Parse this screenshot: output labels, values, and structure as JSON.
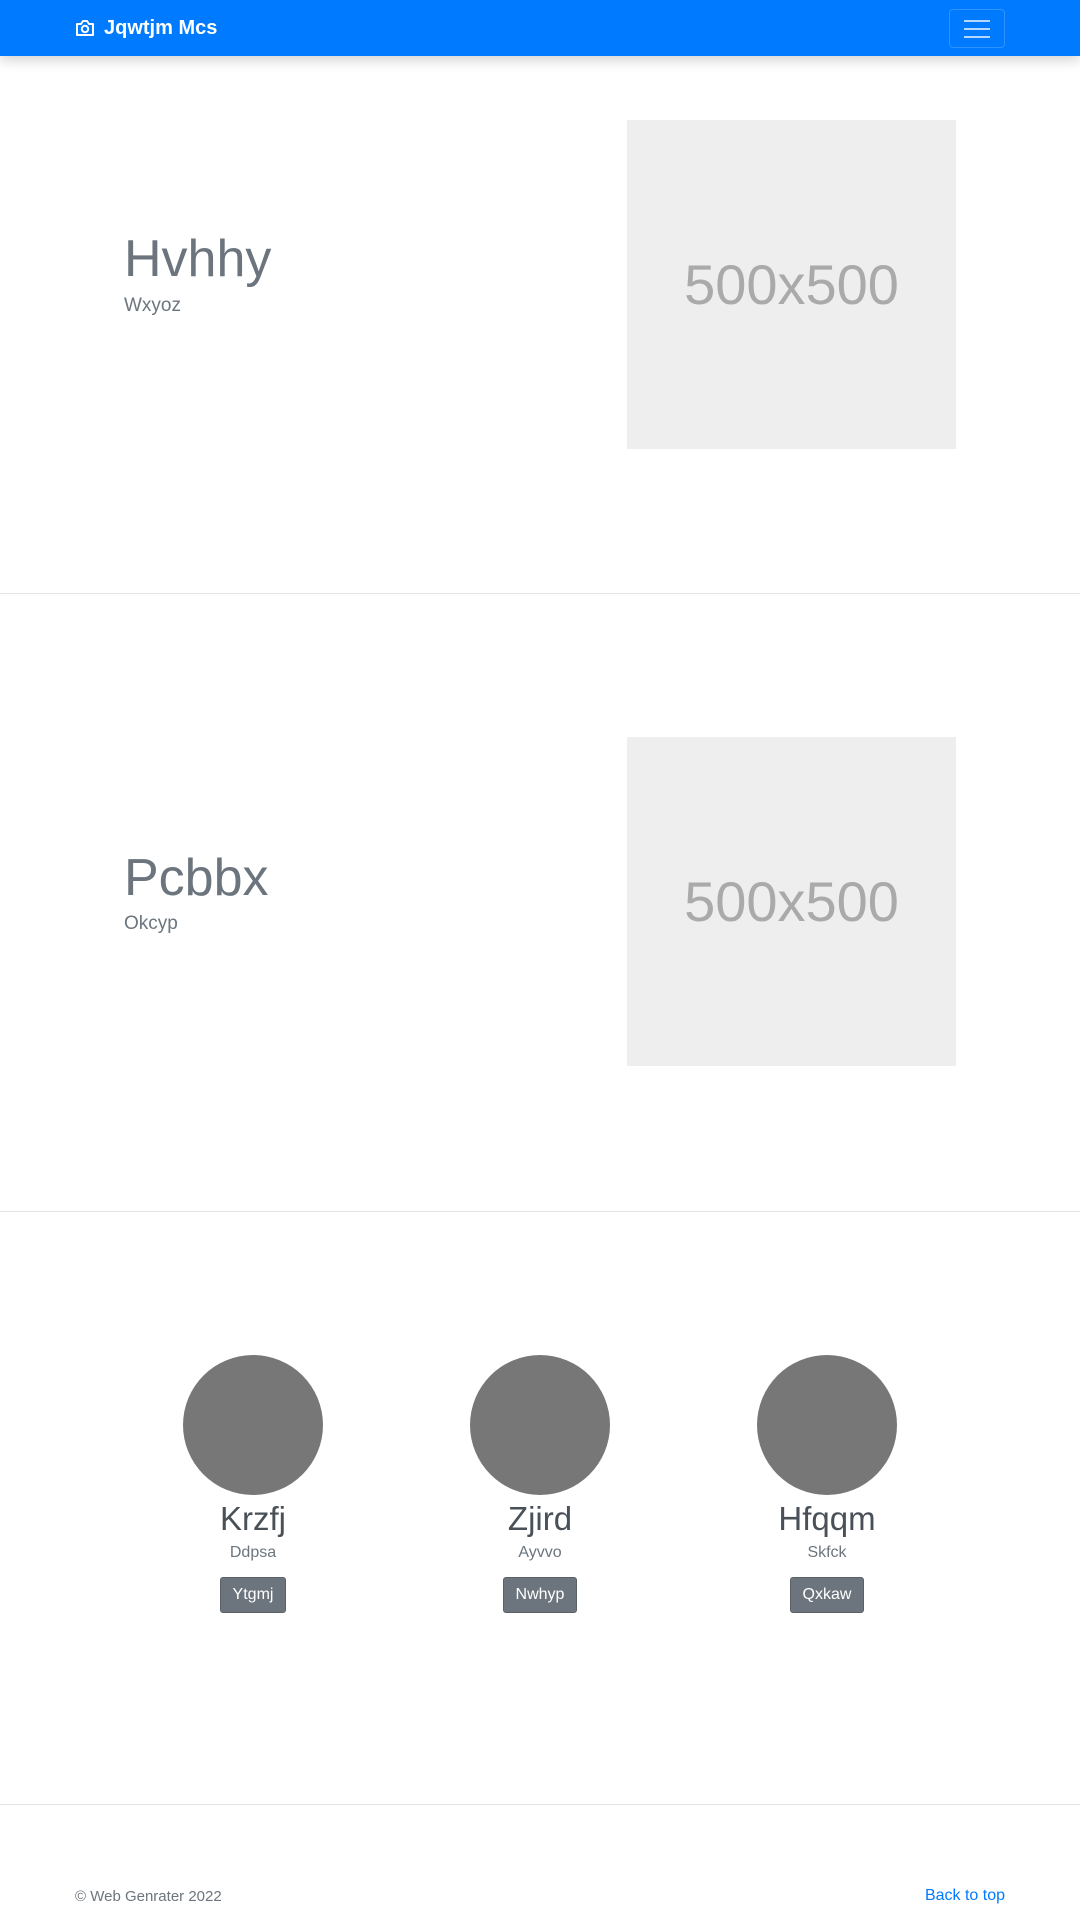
{
  "navbar": {
    "brand": "Jqwtjm Mcs",
    "brand_icon": "camera-icon",
    "toggler_icon": "menu-icon",
    "color": "#007bff"
  },
  "features": [
    {
      "heading": "Hvhhy",
      "subheading": "Wxyoz",
      "image_text": "500x500"
    },
    {
      "heading": "Pcbbx",
      "subheading": "Okcyp",
      "image_text": "500x500"
    }
  ],
  "team": [
    {
      "name": "Krzfj",
      "role": "Ddpsa",
      "button": "Ytgmj"
    },
    {
      "name": "Zjird",
      "role": "Ayvvo",
      "button": "Nwhyp"
    },
    {
      "name": "Hfqqm",
      "role": "Skfck",
      "button": "Qxkaw"
    }
  ],
  "footer": {
    "copyright": "© Web Genrater 2022",
    "back_to_top": "Back to top",
    "link_color": "#007bff"
  }
}
